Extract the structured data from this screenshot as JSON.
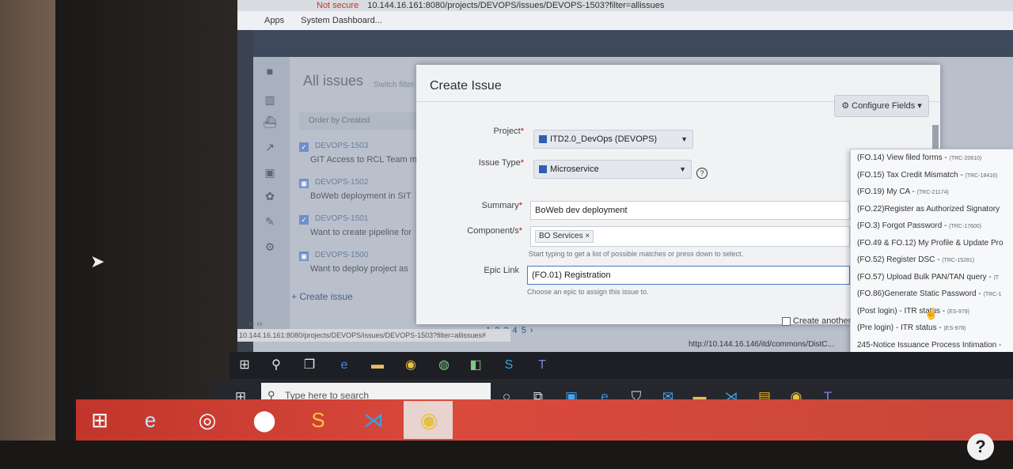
{
  "browser": {
    "warning": "Not secure",
    "url": "10.144.16.161:8080/projects/DEVOPS/issues/DEVOPS-1503?filter=allissues",
    "bookmarks": [
      "Apps",
      "System Dashboard..."
    ],
    "status_url": "10.144.16.161:8080/projects/DEVOPS/issues/DEVOPS-1503?filter=allissues#",
    "right_url": "http://10.144.16.146/itd/commons/DistC..."
  },
  "issues_page": {
    "title": "All issues",
    "switch_filter": "Switch filter",
    "order_by": "Order by Created",
    "issues": [
      {
        "key": "DEVOPS-1503",
        "title": "GIT Access to RCL Team m",
        "check": "✓"
      },
      {
        "key": "DEVOPS-1502",
        "title": "BoWeb deployment in SIT",
        "check": "▣"
      },
      {
        "key": "DEVOPS-1501",
        "title": "Want to create pipeline for",
        "check": "✓"
      },
      {
        "key": "DEVOPS-1500",
        "title": "Want to deploy project as",
        "check": "▣"
      }
    ],
    "create_issue": "+ Create issue",
    "pagination": "1 2 3 4 5 ›",
    "nav": "›› ‹›"
  },
  "dialog": {
    "title": "Create Issue",
    "configure_fields": "Configure Fields",
    "project_label": "Project",
    "project_value": "ITD2.0_DevOps (DEVOPS)",
    "issue_type_label": "Issue Type",
    "issue_type_value": "Microservice",
    "summary_label": "Summary",
    "summary_value": "BoWeb dev deployment",
    "components_label": "Component/s",
    "component_chip": "BO Services",
    "components_hint": "Start typing to get a list of possible matches or press down to select.",
    "epic_label": "Epic Link",
    "epic_value": "(FO.01) Registration",
    "epic_hint": "Choose an epic to assign this issue to.",
    "create_another": "Create another"
  },
  "epic_options": [
    {
      "label": "(FO.14) View filed forms - ",
      "code": "(TRC-20610)"
    },
    {
      "label": "(FO.15) Tax Credit Mismatch - ",
      "code": "(TRC-18416)"
    },
    {
      "label": "(FO.19) My CA - ",
      "code": "(TRC-21174)"
    },
    {
      "label": "(FO.22)Register as Authorized Signatory",
      "code": ""
    },
    {
      "label": "(FO.3) Forgot Password - ",
      "code": "(TRC-17600)"
    },
    {
      "label": "(FO.49 & FO.12) My Profile & Update Pro",
      "code": ""
    },
    {
      "label": "(FO.52) Register DSC - ",
      "code": "(TRC-15281)"
    },
    {
      "label": "(FO.57) Upload Bulk PAN/TAN query - ",
      "code": "(T"
    },
    {
      "label": "(FO.86)Generate Static Password - ",
      "code": "(TRC-1"
    },
    {
      "label": "(Post login) - ITR status - ",
      "code": "(ES-979)"
    },
    {
      "label": "(Pre login) - ITR status - ",
      "code": "(ES-978)"
    },
    {
      "label": "245-Notice Issuance Process Intimation -",
      "code": ""
    }
  ],
  "taskbar": {
    "search_placeholder": "Type here to search"
  },
  "icons": {
    "search": "search-icon",
    "help": "help-icon"
  },
  "colors": {
    "accent": "#2f5fb3",
    "required": "#d0021b",
    "taskbar_red": "#c9463a"
  }
}
